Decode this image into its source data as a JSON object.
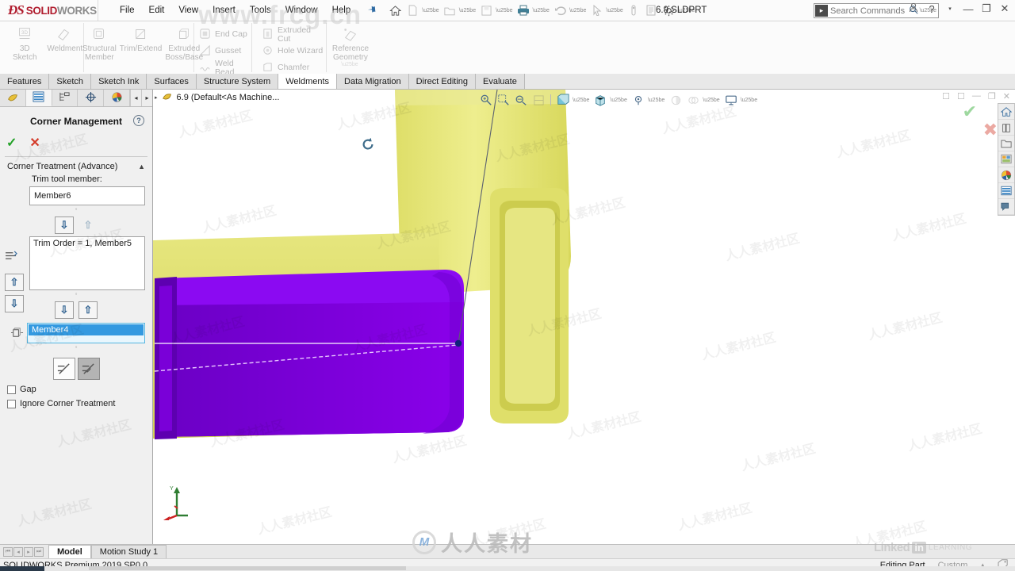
{
  "app": {
    "brand_ds": "ĐS",
    "brand_solid": "SOLID",
    "brand_works": "WORKS",
    "document_title": "6.9.SLDPRT",
    "version_status": "SOLIDWORKS Premium 2019 SP0.0"
  },
  "menu": {
    "items": [
      "File",
      "Edit",
      "View",
      "Insert",
      "Tools",
      "Window",
      "Help"
    ],
    "pin_icon": "pushpin-icon"
  },
  "quick_access": {
    "buttons": [
      {
        "icon": "home-icon",
        "enabled": true
      },
      {
        "icon": "new-document-icon",
        "enabled": false,
        "dropdown": true
      },
      {
        "icon": "open-folder-icon",
        "enabled": false,
        "dropdown": true
      },
      {
        "icon": "save-icon",
        "enabled": false,
        "dropdown": true
      },
      {
        "icon": "print-icon",
        "enabled": true,
        "dropdown": true
      },
      {
        "icon": "undo-icon",
        "enabled": false,
        "dropdown": true
      },
      {
        "icon": "select-arrow-icon",
        "enabled": false,
        "dropdown": true
      },
      {
        "icon": "rebuild-icon",
        "enabled": false
      },
      {
        "icon": "file-properties-icon",
        "enabled": false
      },
      {
        "icon": "options-gear-icon",
        "enabled": true,
        "dropdown": true
      }
    ]
  },
  "search": {
    "placeholder": "Search Commands",
    "icon": "command-search-icon",
    "magnifier": "magnifier-icon"
  },
  "window_controls": {
    "account": "user-account-icon",
    "help": "?",
    "help_caret": "▾",
    "minimize": "—",
    "restore": "❐",
    "close": "✕"
  },
  "ribbon": {
    "groups": [
      {
        "name": "sketch-weldment",
        "commands": [
          {
            "label": "3D\nSketch",
            "icon": "3d-sketch-icon",
            "enabled": false
          },
          {
            "label": "Weldment",
            "icon": "weldment-icon",
            "enabled": false
          }
        ]
      },
      {
        "name": "members",
        "commands": [
          {
            "label": "Structural\nMember",
            "icon": "structural-member-icon",
            "enabled": false
          },
          {
            "label": "Trim/Extend",
            "icon": "trim-extend-icon",
            "enabled": false
          },
          {
            "label": "Extruded\nBoss/Base",
            "icon": "extruded-boss-icon",
            "enabled": false
          }
        ]
      },
      {
        "name": "caps",
        "small_commands": [
          {
            "label": "End Cap",
            "icon": "end-cap-icon",
            "enabled": false
          },
          {
            "label": "Gusset",
            "icon": "gusset-icon",
            "enabled": false
          },
          {
            "label": "Weld Bead",
            "icon": "weld-bead-icon",
            "enabled": false
          }
        ]
      },
      {
        "name": "cuts",
        "small_commands": [
          {
            "label": "Extruded Cut",
            "icon": "extruded-cut-icon",
            "enabled": false
          },
          {
            "label": "Hole Wizard",
            "icon": "hole-wizard-icon",
            "enabled": false
          },
          {
            "label": "Chamfer",
            "icon": "chamfer-icon",
            "enabled": false
          }
        ]
      },
      {
        "name": "reference",
        "commands": [
          {
            "label": "Reference\nGeometry",
            "icon": "reference-geometry-icon",
            "enabled": false
          }
        ]
      }
    ]
  },
  "command_tabs": {
    "items": [
      "Features",
      "Sketch",
      "Sketch Ink",
      "Surfaces",
      "Structure System",
      "Weldments",
      "Data Migration",
      "Direct Editing",
      "Evaluate"
    ],
    "active": "Weldments"
  },
  "property_manager": {
    "tabs": [
      {
        "icon": "feature-tree-icon",
        "name": "feature-manager-tab",
        "active": false
      },
      {
        "icon": "property-manager-icon",
        "name": "property-manager-tab",
        "active": true
      },
      {
        "icon": "configuration-manager-icon",
        "name": "configuration-manager-tab",
        "active": false
      },
      {
        "icon": "dimxpert-icon",
        "name": "dimxpert-manager-tab",
        "active": false
      },
      {
        "icon": "display-manager-icon",
        "name": "display-manager-tab",
        "active": false
      }
    ],
    "nav_left": "◂",
    "nav_right": "▸",
    "title": "Corner Management",
    "help_icon": "?",
    "accept_icon": "✓",
    "cancel_icon": "✕",
    "section": {
      "title": "Corner Treatment (Advance)",
      "collapse_icon": "chevron-up-icon"
    },
    "trim_tool_label": "Trim tool member:",
    "trim_tool_value": "Member6",
    "trim_order_value": "Trim Order = 1, Member5",
    "selected_member": "Member4",
    "move_down_icon": "arrow-down-icon",
    "move_up_icon": "arrow-up-icon",
    "toggle_buttons": [
      {
        "name": "simple-cut-button",
        "icon": "simple-trim-icon",
        "pressed": false
      },
      {
        "name": "coped-cut-button",
        "icon": "coped-trim-icon",
        "pressed": true
      }
    ],
    "checkboxes": [
      {
        "label": "Gap",
        "checked": false
      },
      {
        "label": "Ignore Corner Treatment",
        "checked": false
      }
    ]
  },
  "viewport": {
    "tree_root": "6.9  (Default<As Machine...",
    "tree_icon": "part-icon",
    "tree_expand": "▸",
    "rotate_icon": "rotate-view-icon",
    "confirm_overlay": "✔",
    "cancel_overlay": "✖",
    "heads_up": [
      {
        "icon": "zoom-to-fit-icon",
        "enabled": true
      },
      {
        "icon": "zoom-to-area-icon",
        "enabled": true
      },
      {
        "icon": "previous-view-icon",
        "enabled": true
      },
      {
        "icon": "section-view-icon",
        "enabled": false
      },
      {
        "icon": "view-orientation-icon",
        "enabled": true,
        "dropdown": true
      },
      {
        "icon": "display-style-icon",
        "enabled": true,
        "dropdown": true
      },
      {
        "icon": "hide-show-items-icon",
        "enabled": true,
        "dropdown": true
      },
      {
        "icon": "edit-appearance-icon",
        "enabled": false,
        "dropdown": true
      },
      {
        "icon": "apply-scene-icon",
        "enabled": false,
        "dropdown": true
      },
      {
        "icon": "view-settings-icon",
        "enabled": true,
        "dropdown": true
      }
    ],
    "window_buttons": [
      "◳",
      "◳",
      "—",
      "❐",
      "✕"
    ],
    "model": {
      "trim_member_color": "#7d00e0",
      "body_color": "#e8e87a",
      "vertex_color": "#11227a"
    },
    "triad": {
      "x_axis": "#cc2222",
      "y_axis": "#1e7d32",
      "z_axis": "#cc2222"
    }
  },
  "task_pane": {
    "buttons": [
      {
        "icon": "solidworks-resources-icon"
      },
      {
        "icon": "design-library-icon"
      },
      {
        "icon": "file-explorer-icon"
      },
      {
        "icon": "view-palette-icon"
      },
      {
        "icon": "appearances-scenes-icon"
      },
      {
        "icon": "custom-properties-icon"
      },
      {
        "icon": "solidworks-forum-icon"
      }
    ]
  },
  "bottom_tabs": {
    "nav": [
      "⏮",
      "◂",
      "▸",
      "⏭"
    ],
    "items": [
      {
        "label": "Model",
        "active": true
      },
      {
        "label": "Motion Study 1",
        "active": false
      }
    ]
  },
  "status_bar": {
    "left": "SOLIDWORKS Premium 2019 SP0.0",
    "editing": "Editing Part",
    "units": "Custom",
    "units_caret": "▴",
    "tag_icon": "tag-icon"
  },
  "watermarks": {
    "frcg": "www.frcg.cn",
    "site_cn": "人人素材",
    "tile_cn": "人人素材社区",
    "ring_letter": "M",
    "linkedin": "Linked",
    "linkedin_in": "in",
    "linkedin_learning": "LEARNING"
  }
}
